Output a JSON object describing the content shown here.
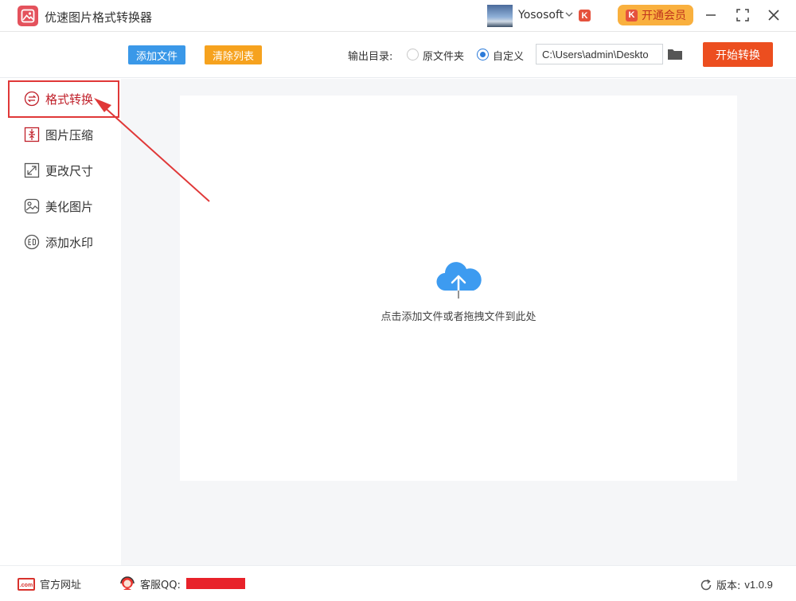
{
  "app": {
    "title": "优速图片格式转换器",
    "user_name": "Yososoft",
    "vip_label": "开通会员",
    "k_badge": "K"
  },
  "toolbar": {
    "add_files_label": "添加文件",
    "clear_list_label": "清除列表",
    "output_dir_label": "输出目录:",
    "radio_original_label": "原文件夹",
    "radio_custom_label": "自定义",
    "selected_output": "自定义",
    "output_path_value": "C:\\Users\\admin\\Deskto",
    "start_label": "开始转换"
  },
  "sidebar": {
    "items": [
      {
        "label": "格式转换",
        "icon": "convert-icon",
        "active": true
      },
      {
        "label": "图片压缩",
        "icon": "compress-icon",
        "active": false
      },
      {
        "label": "更改尺寸",
        "icon": "resize-icon",
        "active": false
      },
      {
        "label": "美化图片",
        "icon": "beautify-icon",
        "active": false
      },
      {
        "label": "添加水印",
        "icon": "watermark-icon",
        "active": false
      }
    ]
  },
  "main": {
    "drop_hint": "点击添加文件或者拖拽文件到此处",
    "icon": "cloud-upload-icon"
  },
  "footer": {
    "site_icon_text": ".com",
    "site_label": "官方网址",
    "qq_label": "客服QQ:",
    "version_label": "版本:",
    "version_value": "v1.0.9"
  },
  "colors": {
    "accent_blue": "#3a98e8",
    "accent_orange": "#f6a21e",
    "start_red": "#ec4e1f",
    "active_red": "#c0202a",
    "annotation_red": "#e03838",
    "cloud_blue": "#3d9bf0"
  }
}
